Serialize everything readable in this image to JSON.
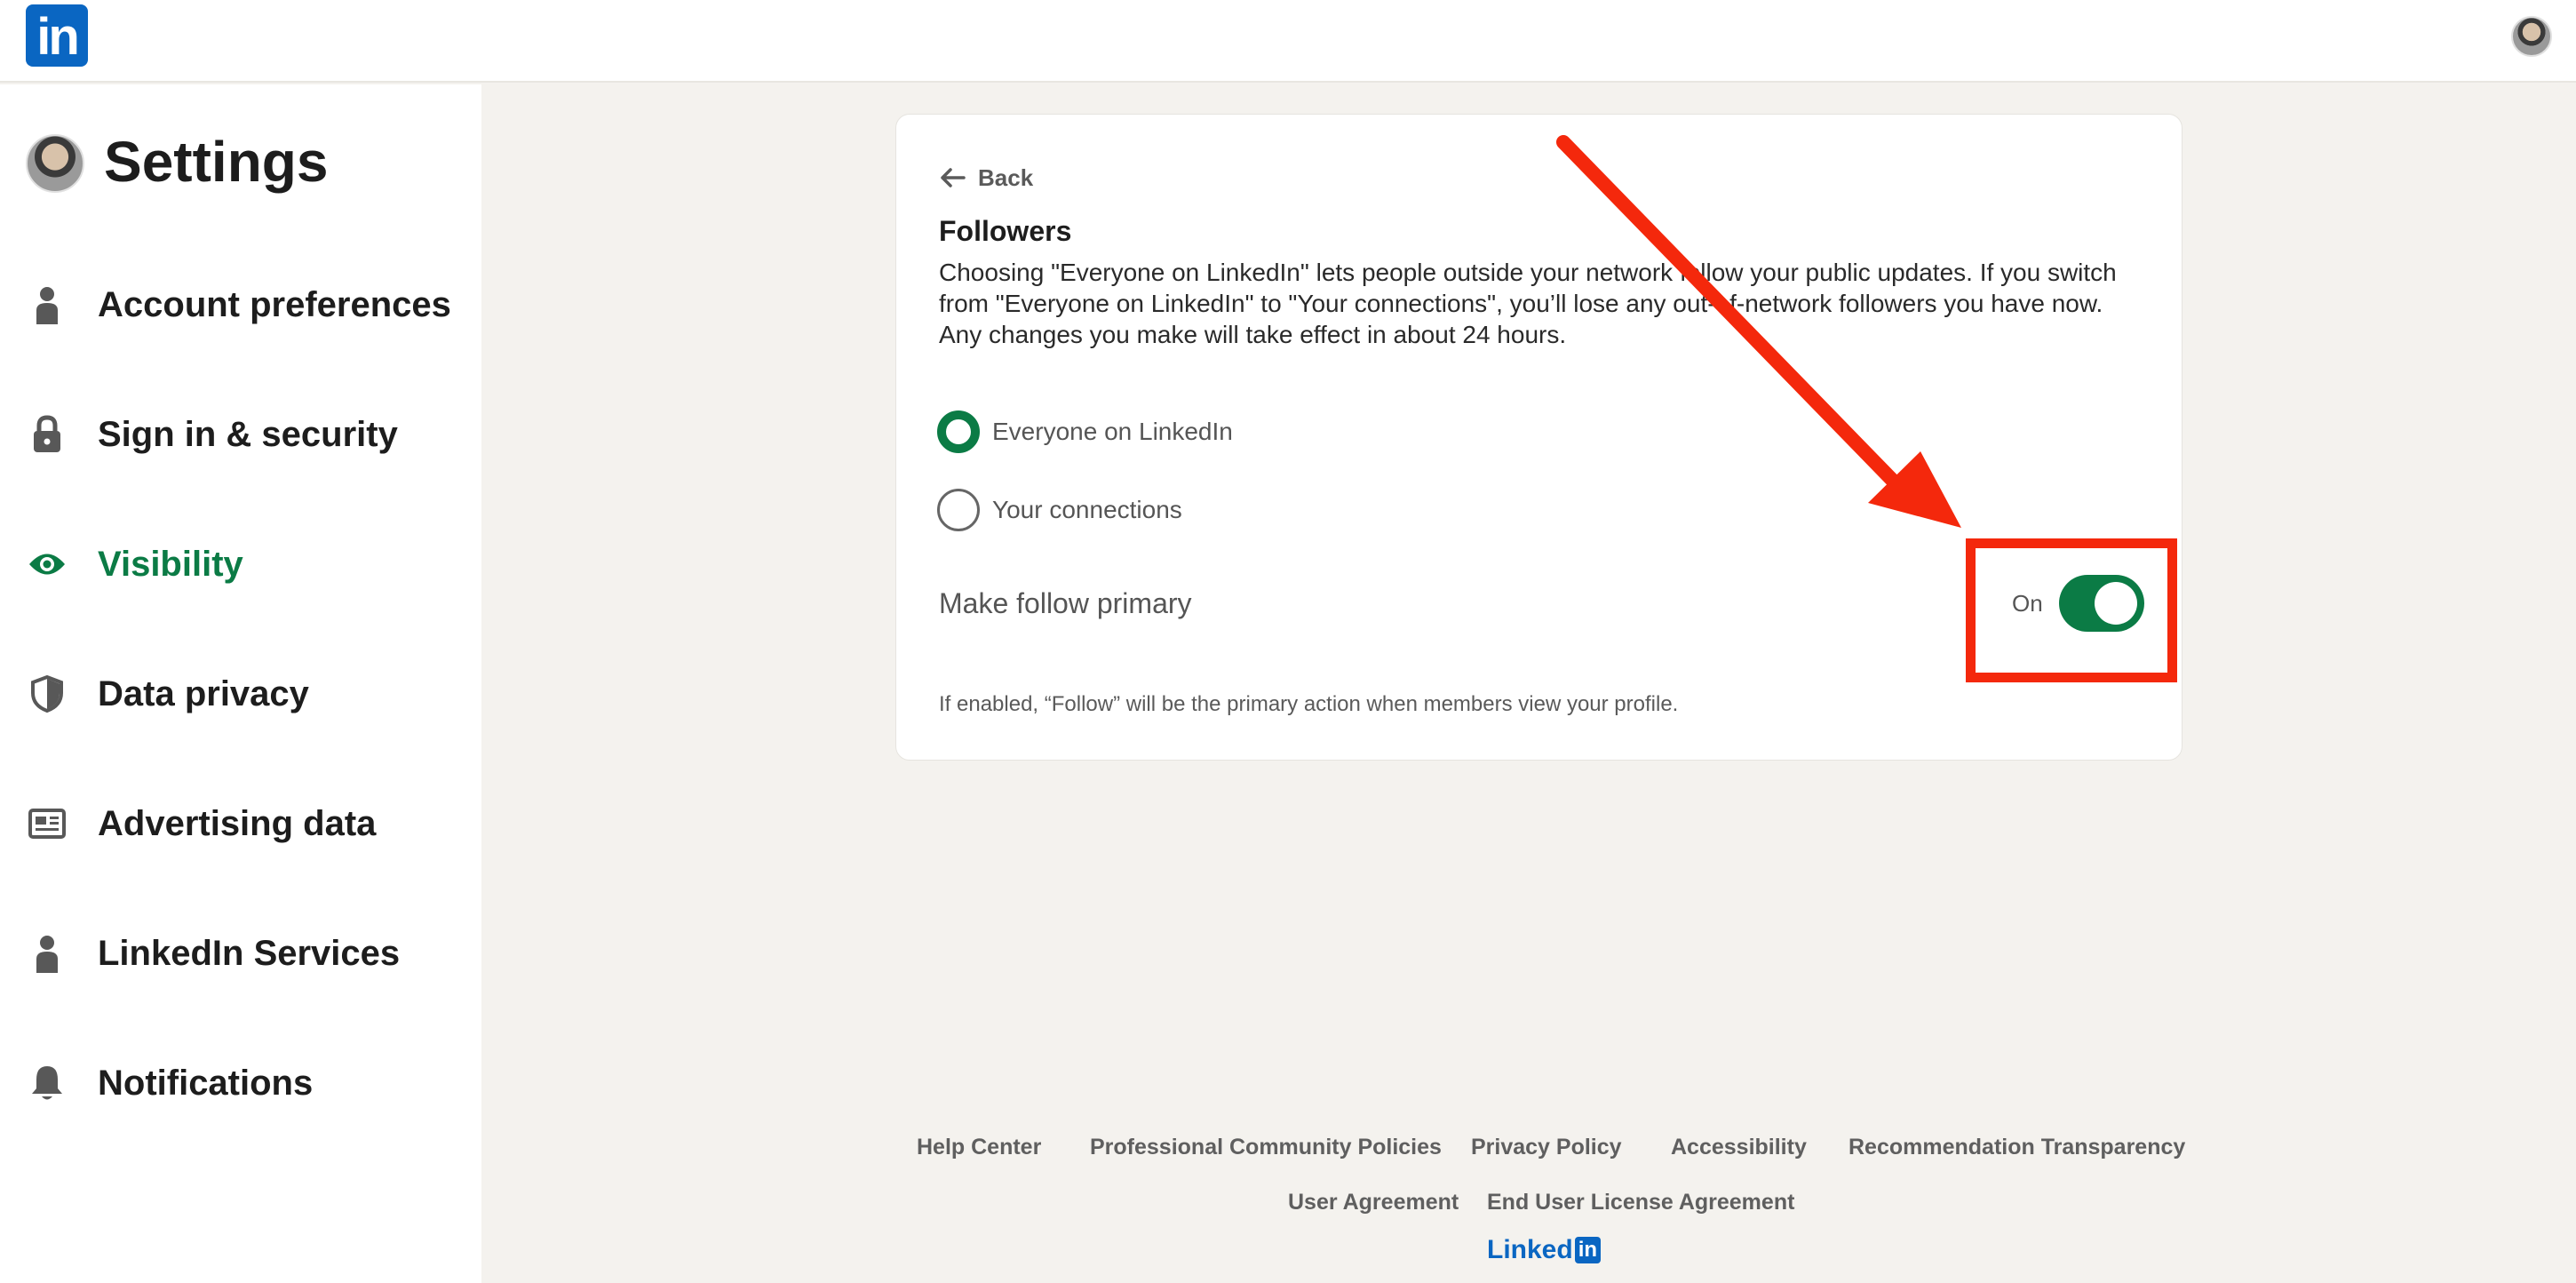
{
  "header": {
    "logo_text": "in"
  },
  "sidebar": {
    "title": "Settings",
    "items": [
      {
        "label": "Account preferences",
        "icon": "person-icon"
      },
      {
        "label": "Sign in & security",
        "icon": "lock-icon"
      },
      {
        "label": "Visibility",
        "icon": "eye-icon",
        "active": true
      },
      {
        "label": "Data privacy",
        "icon": "shield-icon"
      },
      {
        "label": "Advertising data",
        "icon": "newspaper-icon"
      },
      {
        "label": "LinkedIn Services",
        "icon": "person-icon"
      },
      {
        "label": "Notifications",
        "icon": "bell-icon"
      }
    ]
  },
  "card": {
    "back_label": "Back",
    "title": "Followers",
    "description": "Choosing \"Everyone on LinkedIn\" lets people outside your network follow your public updates. If you switch from \"Everyone on LinkedIn\" to \"Your connections\", you’ll lose any out-of-network followers you have now. Any changes you make will take effect in about 24 hours.",
    "options": [
      {
        "label": "Everyone on LinkedIn",
        "selected": true
      },
      {
        "label": "Your connections",
        "selected": false
      }
    ],
    "follow_primary_label": "Make follow primary",
    "toggle_state": "On",
    "hint": "If enabled, “Follow” will be the primary action when members view your profile."
  },
  "footer": {
    "links_row1": [
      "Help Center",
      "Professional Community Policies",
      "Privacy Policy",
      "Accessibility",
      "Recommendation Transparency"
    ],
    "links_row2": [
      "User Agreement",
      "End User License Agreement"
    ],
    "brand_text": "Linked",
    "brand_box": "in"
  },
  "colors": {
    "accent": "#0b7b45",
    "brand": "#0a66c2",
    "annotation": "#f4280c"
  }
}
